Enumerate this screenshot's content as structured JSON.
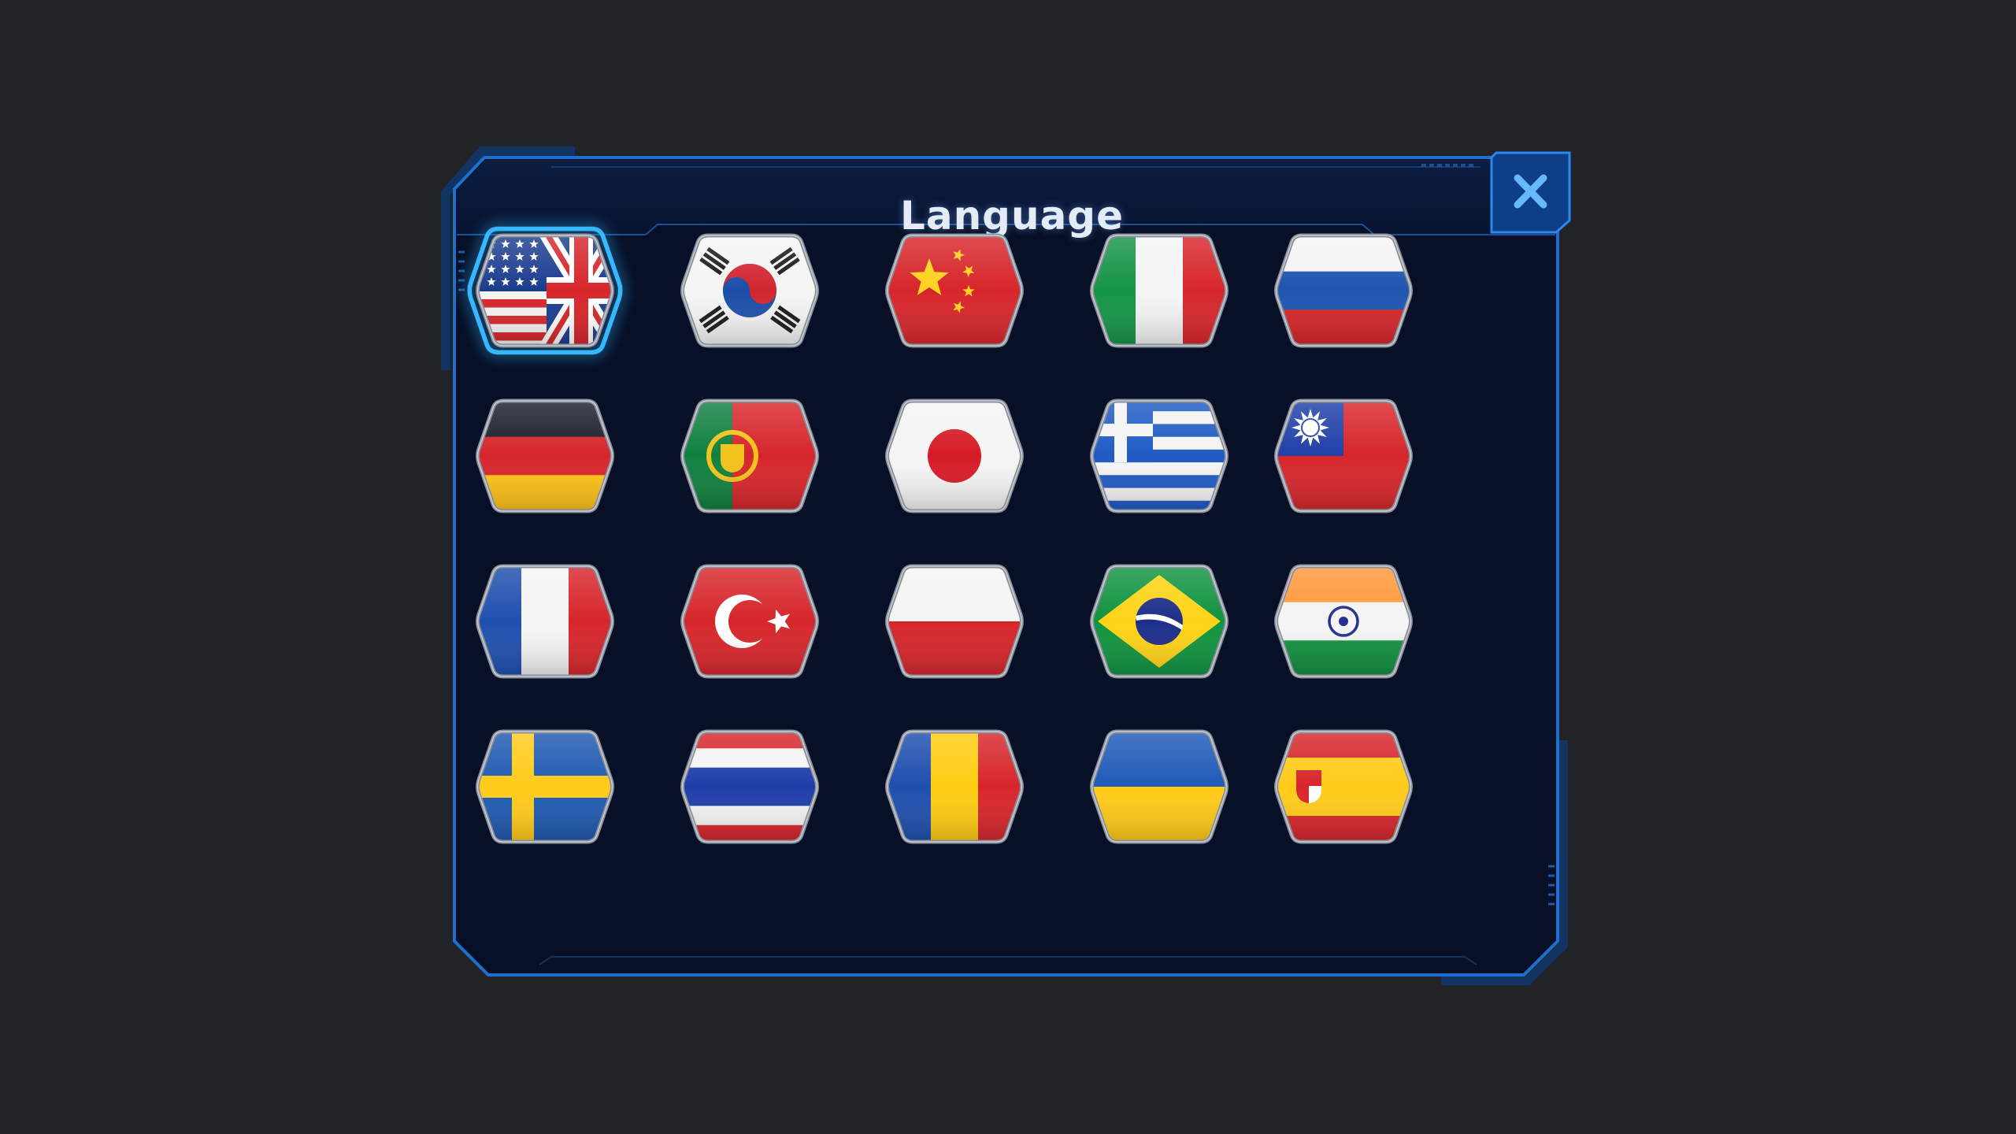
{
  "dialog": {
    "title": "Language",
    "close_icon": "close-x-icon",
    "accent_color": "#1f6fd0",
    "panel_color": "#071027",
    "selected_glow_color": "#35b8ff"
  },
  "languages": [
    {
      "flag": "us-uk",
      "selected": true
    },
    {
      "flag": "south-korea",
      "selected": false
    },
    {
      "flag": "china",
      "selected": false
    },
    {
      "flag": "italy",
      "selected": false
    },
    {
      "flag": "russia",
      "selected": false
    },
    {
      "flag": "germany",
      "selected": false
    },
    {
      "flag": "portugal",
      "selected": false
    },
    {
      "flag": "japan",
      "selected": false
    },
    {
      "flag": "greece",
      "selected": false
    },
    {
      "flag": "taiwan",
      "selected": false
    },
    {
      "flag": "france",
      "selected": false
    },
    {
      "flag": "turkey",
      "selected": false
    },
    {
      "flag": "poland",
      "selected": false
    },
    {
      "flag": "brazil",
      "selected": false
    },
    {
      "flag": "india",
      "selected": false
    },
    {
      "flag": "sweden",
      "selected": false
    },
    {
      "flag": "thailand",
      "selected": false
    },
    {
      "flag": "romania",
      "selected": false
    },
    {
      "flag": "ukraine",
      "selected": false
    },
    {
      "flag": "spain",
      "selected": false
    }
  ]
}
